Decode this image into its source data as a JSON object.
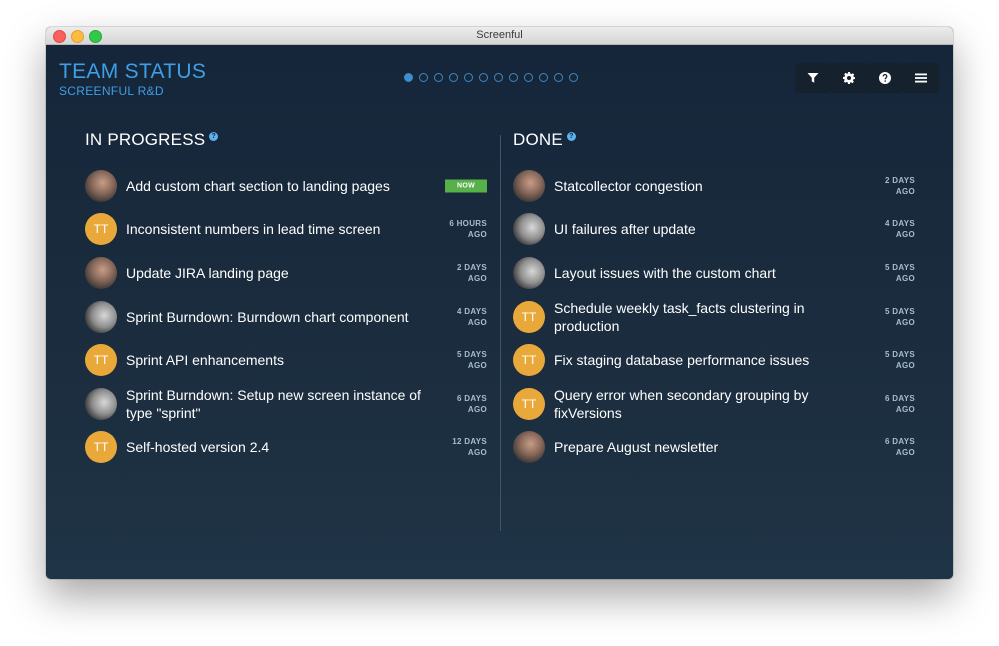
{
  "window": {
    "title": "Screenful"
  },
  "brand": {
    "title": "TEAM STATUS",
    "subtitle": "SCREENFUL R&D"
  },
  "pager": {
    "count": 12,
    "active": 0
  },
  "toolbar": [
    {
      "name": "filter-button",
      "icon": "filter-icon"
    },
    {
      "name": "settings-button",
      "icon": "gear-icon"
    },
    {
      "name": "help-button",
      "icon": "question-icon"
    },
    {
      "name": "menu-button",
      "icon": "hamburger-menu-icon"
    }
  ],
  "in_progress": {
    "heading": "IN PROGRESS",
    "items": [
      {
        "avatar": "photo1",
        "initials": "",
        "title": "Add custom chart section to landing pages",
        "time1": "",
        "time2": "",
        "badge": "NOW"
      },
      {
        "avatar": "initials",
        "initials": "TT",
        "title": "Inconsistent numbers in lead time screen",
        "time1": "6 HOURS",
        "time2": "AGO",
        "badge": ""
      },
      {
        "avatar": "photo1",
        "initials": "",
        "title": "Update JIRA landing page",
        "time1": "2 DAYS",
        "time2": "AGO",
        "badge": ""
      },
      {
        "avatar": "photo2",
        "initials": "",
        "title": "Sprint Burndown: Burndown chart component",
        "time1": "4 DAYS",
        "time2": "AGO",
        "badge": ""
      },
      {
        "avatar": "initials",
        "initials": "TT",
        "title": "Sprint API enhancements",
        "time1": "5 DAYS",
        "time2": "AGO",
        "badge": ""
      },
      {
        "avatar": "photo2",
        "initials": "",
        "title": "Sprint Burndown: Setup new screen instance of type \"sprint\"",
        "time1": "6 DAYS",
        "time2": "AGO",
        "badge": ""
      },
      {
        "avatar": "initials",
        "initials": "TT",
        "title": "Self-hosted version 2.4",
        "time1": "12 DAYS",
        "time2": "AGO",
        "badge": ""
      }
    ]
  },
  "done": {
    "heading": "DONE",
    "items": [
      {
        "avatar": "photo1",
        "initials": "",
        "title": "Statcollector congestion",
        "time1": "2 DAYS",
        "time2": "AGO",
        "badge": ""
      },
      {
        "avatar": "photo2",
        "initials": "",
        "title": "UI failures after update",
        "time1": "4 DAYS",
        "time2": "AGO",
        "badge": ""
      },
      {
        "avatar": "photo2",
        "initials": "",
        "title": "Layout issues with the custom chart",
        "time1": "5 DAYS",
        "time2": "AGO",
        "badge": ""
      },
      {
        "avatar": "initials",
        "initials": "TT",
        "title": "Schedule weekly task_facts clustering in production",
        "time1": "5 DAYS",
        "time2": "AGO",
        "badge": ""
      },
      {
        "avatar": "initials",
        "initials": "TT",
        "title": "Fix staging database performance issues",
        "time1": "5 DAYS",
        "time2": "AGO",
        "badge": ""
      },
      {
        "avatar": "initials",
        "initials": "TT",
        "title": "Query error when secondary grouping by fixVersions",
        "time1": "6 DAYS",
        "time2": "AGO",
        "badge": ""
      },
      {
        "avatar": "photo1",
        "initials": "",
        "title": "Prepare August newsletter",
        "time1": "6 DAYS",
        "time2": "AGO",
        "badge": ""
      }
    ]
  },
  "colors": {
    "accent": "#3d9fe6",
    "initials_avatar": "#e9a93a",
    "now_badge": "#58b04a"
  }
}
